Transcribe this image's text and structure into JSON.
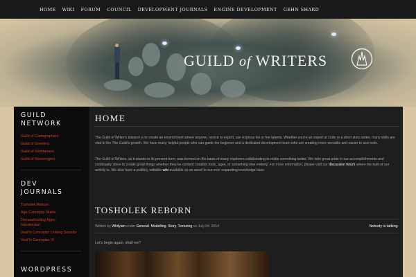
{
  "nav": {
    "items": [
      "HOME",
      "WIKI",
      "FORUM",
      "COUNCIL",
      "DEVELOPMENT JOURNALS",
      "ENGINE DEVELOPMENT",
      "GEHN SHARD"
    ]
  },
  "header": {
    "logo_word1": "GUILD",
    "logo_word2": "of",
    "logo_word3": "WRITERS"
  },
  "sidebar": {
    "guild_network": {
      "title_line1": "GUILD",
      "title_line2": "NETWORK",
      "items": [
        "Guild of Cartographers",
        "Guild of Greeters",
        "Guild of Maintainers",
        "Guild of Messengers"
      ]
    },
    "dev_journals": {
      "title_line1": "DEV",
      "title_line2": "JOURNALS",
      "items": [
        "Tosholek Reborn",
        "Age Concepts: Mahe",
        "Deconstructing Ages: Introduction",
        "Vaal'Iri Concepts: Linking Sounds",
        "Vaal'Iri Concepts: IV"
      ]
    },
    "wordpress": {
      "title": "WORDPRESS"
    }
  },
  "main": {
    "page_title": "HOME",
    "para1": "The Guild of Writer's mission is to create an environment where anyone, novice to expert, can express his or her talents. Whether you're an expert at code or a short story writer, many skills are vital to the The Guild's growth. We have many helpful people who can guide the beginner and a dedicated development team who are creating more versatile and easier to use tools.",
    "para2_a": "The Guild of Writers, as it stands in its present form, was formed on the basis of many explorers collaborating to make something better. We take great pride in our accomplishments and continually strive to create great things whether they be content creation tools, ages, or something else entirely. For more information, please visit our ",
    "para2_link1": "discussion forum",
    "para2_b": " where the bulk of our activity is. We also have a publicly editable ",
    "para2_link2": "wiki",
    "para2_c": " available as an asset to our ever expanding knowledge base.",
    "post": {
      "title": "TOSHOLEK REBORN",
      "written_by": "Written by ",
      "author": "Whilyam",
      "under": " under ",
      "cat1": "General",
      "sep1": ", ",
      "cat2": "Modelling",
      "sep2": ", ",
      "cat3": "Story",
      "sep3": ", ",
      "cat4": "Texturing",
      "on_date": " on July 04, 2014",
      "comments": "Nobody is talking.",
      "body": "Let's begin again, shall we?"
    }
  },
  "colors": {
    "accent_link": "#e23a2a",
    "page_bg": "#d9c7a4",
    "nav_bg": "#191919"
  }
}
